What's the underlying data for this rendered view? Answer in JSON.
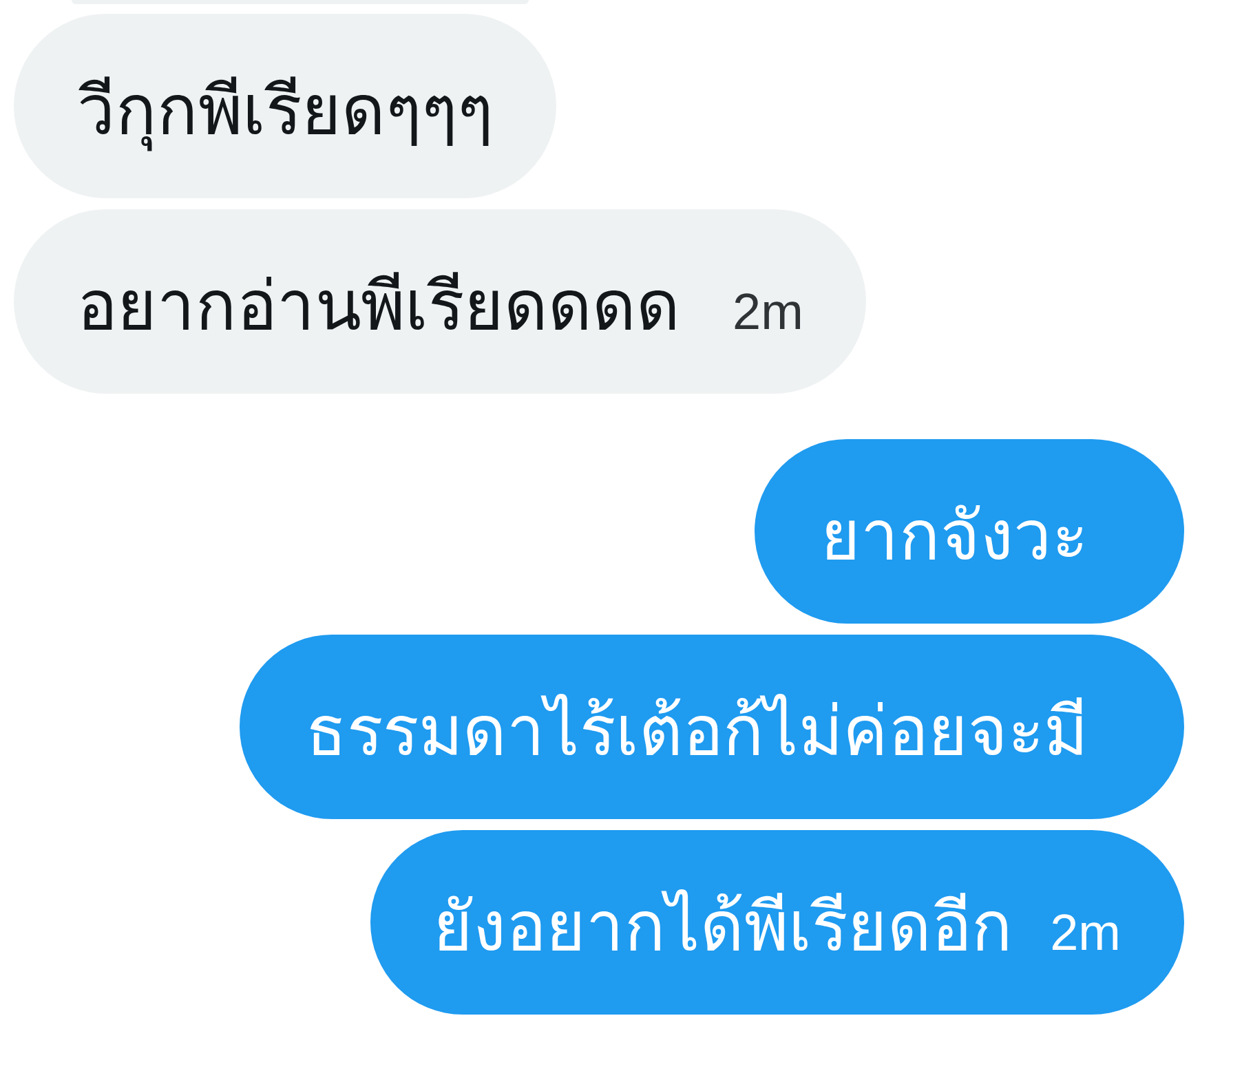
{
  "messages": [
    {
      "kind": "received"
    },
    {
      "kind": "received",
      "text": "วีกุกพีเรียดๆๆๆ"
    },
    {
      "kind": "received",
      "text": "อยากอ่านพีเรียดดดด",
      "time": "2m"
    },
    {
      "kind": "sent",
      "text": "ยากจังวะ"
    },
    {
      "kind": "sent",
      "text": "ธรรมดาไร้เต้อก้ไม่ค่อยจะมี"
    },
    {
      "kind": "sent",
      "text": "ยังอยากได้พีเรียดอีก",
      "time": "2m"
    }
  ]
}
